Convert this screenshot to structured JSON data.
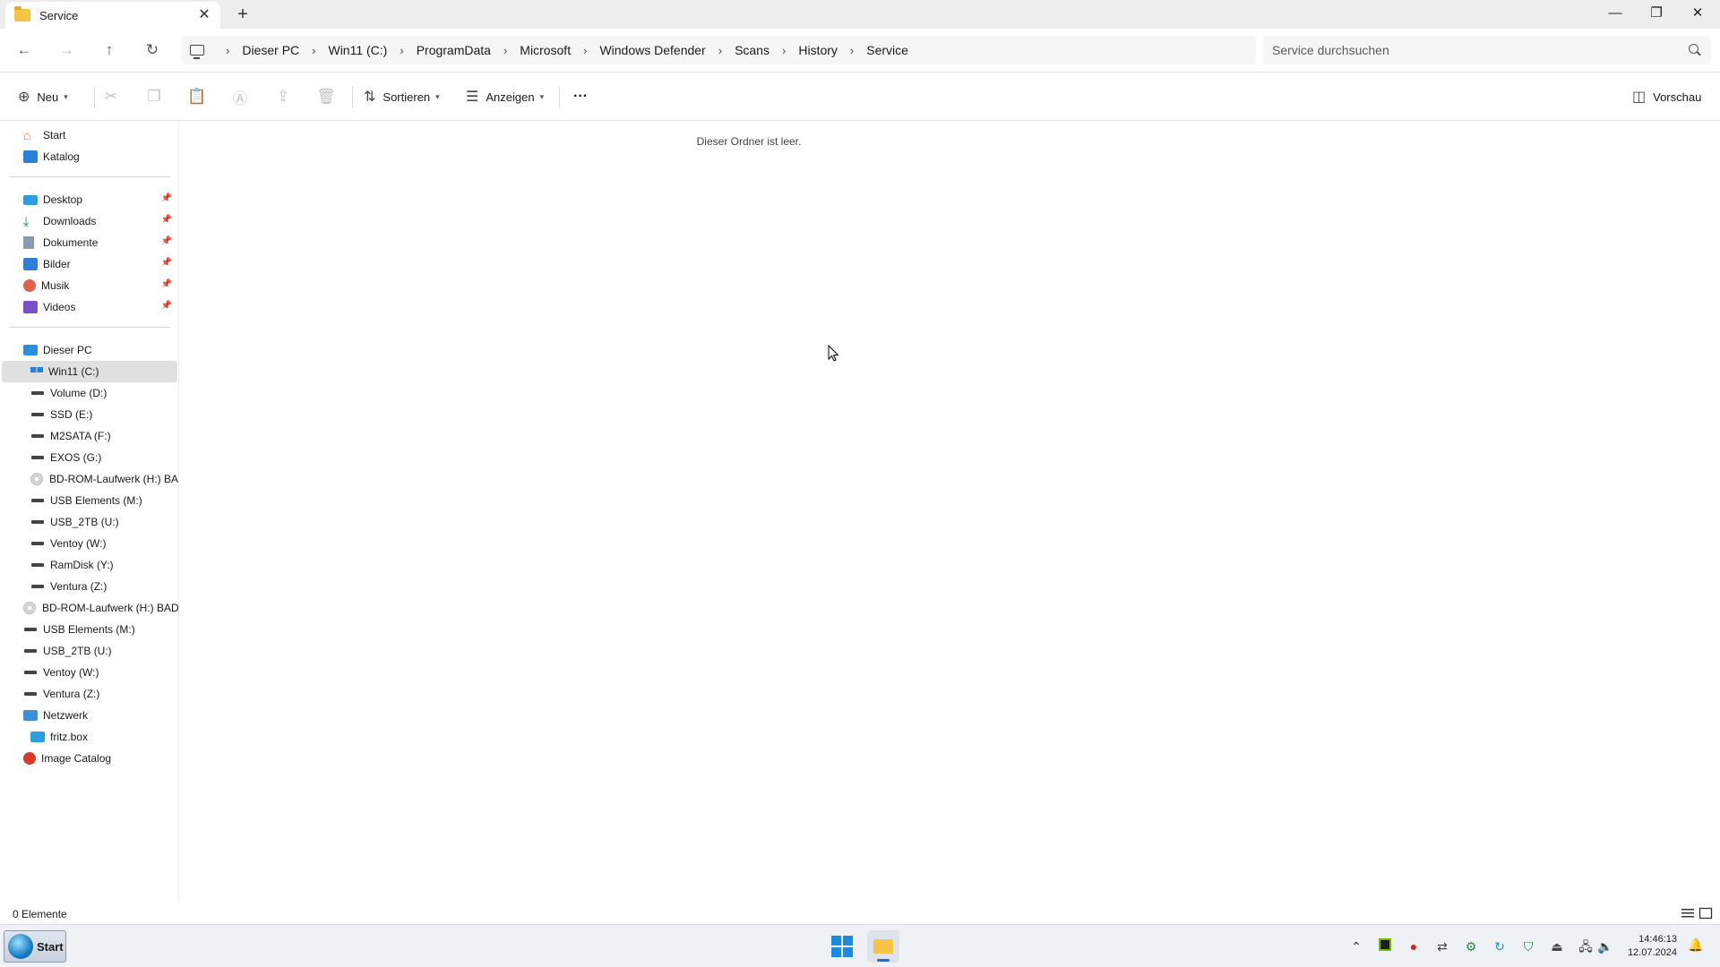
{
  "window": {
    "tab_title": "Service",
    "new_tab": "+",
    "close_tab": "✕",
    "minimize": "—",
    "restore": "❐",
    "close": "✕"
  },
  "address": {
    "crumbs": [
      "Dieser PC",
      "Win11 (C:)",
      "ProgramData",
      "Microsoft",
      "Windows Defender",
      "Scans",
      "History",
      "Service"
    ],
    "separator": "›",
    "search_placeholder": "Service durchsuchen"
  },
  "toolbar": {
    "new_label": "Neu",
    "sort_label": "Sortieren",
    "view_label": "Anzeigen",
    "more_label": "···",
    "preview_label": "Vorschau"
  },
  "sidebar": {
    "quick": [
      {
        "label": "Start"
      },
      {
        "label": "Katalog"
      }
    ],
    "pinned": [
      {
        "label": "Desktop"
      },
      {
        "label": "Downloads"
      },
      {
        "label": "Dokumente"
      },
      {
        "label": "Bilder"
      },
      {
        "label": "Musik"
      },
      {
        "label": "Videos"
      }
    ],
    "this_pc": "Dieser PC",
    "drives": [
      "Win11 (C:)",
      "Volume (D:)",
      "SSD (E:)",
      "M2SATA (F:)",
      "EXOS (G:)",
      "BD-ROM-Laufwerk (H:) BAD_",
      "USB Elements (M:)",
      "USB_2TB (U:)",
      "Ventoy (W:)",
      "RamDisk (Y:)",
      "Ventura (Z:)"
    ],
    "top_level": [
      "BD-ROM-Laufwerk (H:) BAD_",
      "USB Elements (M:)",
      "USB_2TB (U:)",
      "Ventoy (W:)",
      "Ventura (Z:)"
    ],
    "network": "Netzwerk",
    "network_child": "fritz.box",
    "image_catalog": "Image Catalog"
  },
  "main": {
    "empty_message": "Dieser Ordner ist leer."
  },
  "status": {
    "count": "0 Elemente"
  },
  "taskbar": {
    "start_label": "Start",
    "time": "14:46:13",
    "date": "12.07.2024"
  }
}
